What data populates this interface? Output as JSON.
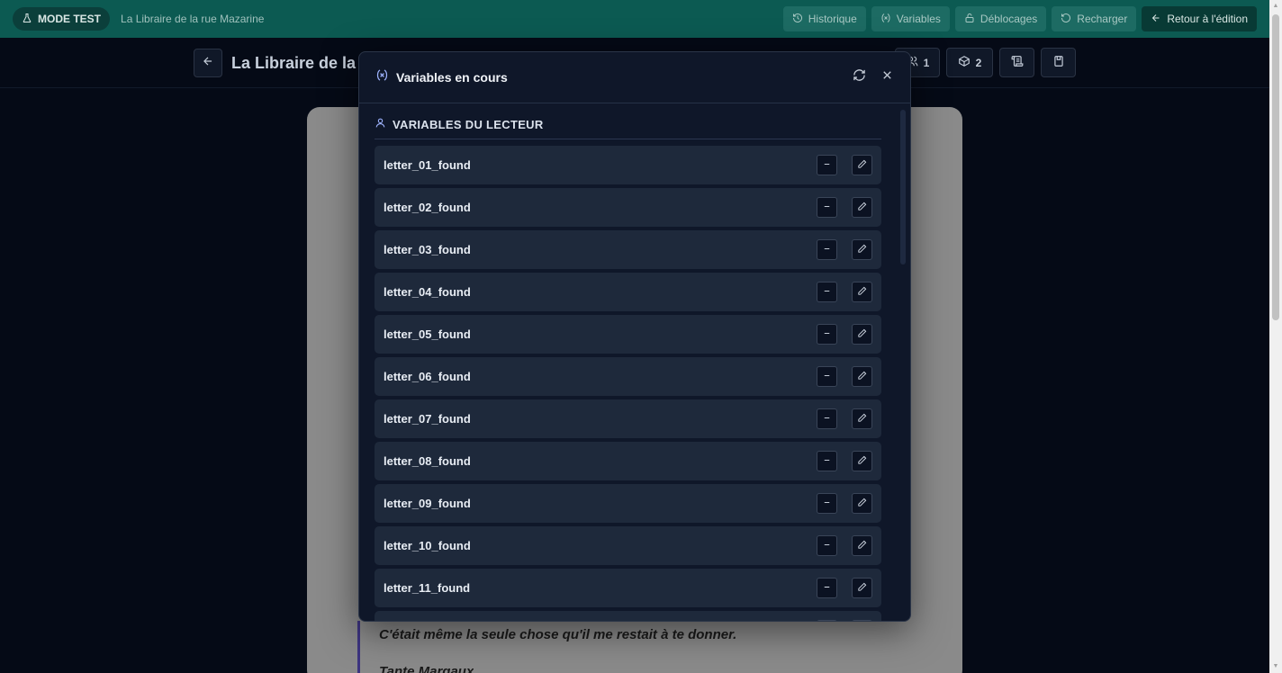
{
  "topbar": {
    "mode_label": "MODE TEST",
    "story_name": "La Libraire de la rue Mazarine",
    "actions": [
      {
        "label": "Historique",
        "icon": "history-icon"
      },
      {
        "label": "Variables",
        "icon": "variable-icon"
      },
      {
        "label": "Déblocages",
        "icon": "unlock-icon"
      },
      {
        "label": "Recharger",
        "icon": "reload-icon"
      },
      {
        "label": "Retour à l'édition",
        "icon": "arrow-left-icon"
      }
    ]
  },
  "reader": {
    "title": "La Libraire de la rue Mazarine",
    "characters_count": "1",
    "items_count": "2"
  },
  "book": {
    "quote_line": "C'était même la seule chose qu'il me restait à te donner.",
    "signature": "Tante Margaux"
  },
  "modal": {
    "title": "Variables en cours",
    "section_title": "VARIABLES DU LECTEUR",
    "variables": [
      "letter_01_found",
      "letter_02_found",
      "letter_03_found",
      "letter_04_found",
      "letter_05_found",
      "letter_06_found",
      "letter_07_found",
      "letter_08_found",
      "letter_09_found",
      "letter_10_found",
      "letter_11_found",
      ""
    ]
  }
}
